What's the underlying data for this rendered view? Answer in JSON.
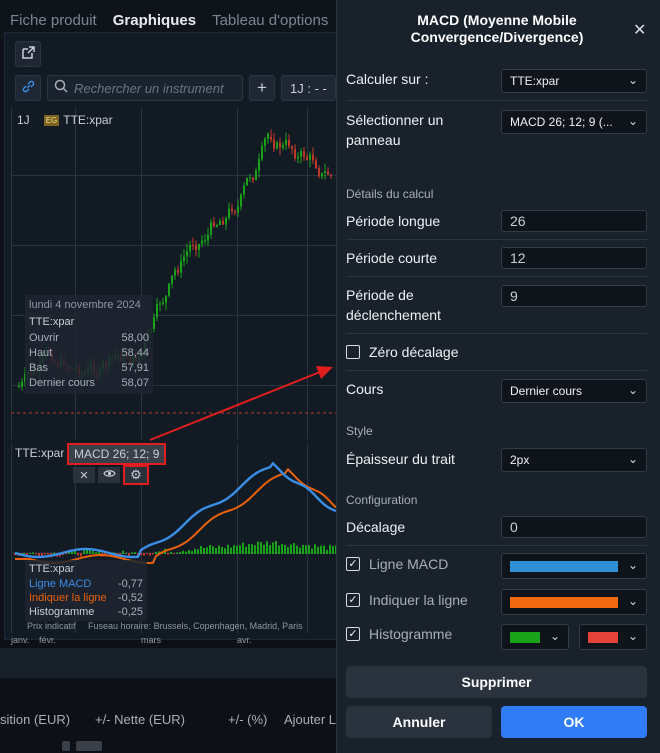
{
  "tabs": [
    "Fiche produit",
    "Graphiques",
    "Tableau d'options"
  ],
  "chart": {
    "search_placeholder": "Rechercher un instrument",
    "timeframe": "1J : - -",
    "period_label": "1J",
    "exchange_badge": "EG",
    "instrument": "TTE:xpar",
    "tooltip_main": {
      "date": "lundi 4 novembre 2024",
      "symbol": "TTE:xpar",
      "rows": [
        {
          "label": "Ouvrir",
          "value": "58,00"
        },
        {
          "label": "Haut",
          "value": "58,44"
        },
        {
          "label": "Bas",
          "value": "57,91"
        },
        {
          "label": "Dernier cours",
          "value": "58,07"
        }
      ]
    },
    "macd_label": "MACD 26; 12; 9",
    "sub_instrument": "TTE:xpar",
    "tooltip_sub": {
      "symbol": "TTE:xpar",
      "rows": [
        {
          "label": "Ligne MACD",
          "value": "-0,77",
          "color": "#3a8ee6"
        },
        {
          "label": "Indiquer la ligne",
          "value": "-0,52",
          "color": "#e8620c"
        },
        {
          "label": "Histogramme",
          "value": "-0,25",
          "color": "#c8cfd9"
        }
      ]
    },
    "axis_note": "Prix indicatif",
    "timezone": "Fuseau horaire: Brussels, Copenhagen, Madrid, Paris",
    "months": [
      "janv.",
      "févr.",
      "mars",
      "avr."
    ]
  },
  "bottom_headers": {
    "position": "sition (EUR)",
    "net": "+/- Nette (EUR)",
    "pct": "+/- (%)",
    "add": "Ajouter L"
  },
  "dialog": {
    "title": "MACD (Moyenne Mobile Convergence/Divergence)",
    "calc_on_label": "Calculer sur :",
    "calc_on_value": "TTE:xpar",
    "panel_label": "Sélectionner un panneau",
    "panel_value": "MACD 26; 12; 9 (...",
    "details_section": "Détails du calcul",
    "long_period_label": "Période longue",
    "long_period_value": "26",
    "short_period_label": "Période courte",
    "short_period_value": "12",
    "trigger_label": "Période de déclenchement",
    "trigger_value": "9",
    "zero_offset_label": "Zéro décalage",
    "price_label": "Cours",
    "price_value": "Dernier cours",
    "style_section": "Style",
    "thickness_label": "Épaisseur du trait",
    "thickness_value": "2px",
    "config_section": "Configuration",
    "offset_label": "Décalage",
    "offset_value": "0",
    "macd_line_label": "Ligne MACD",
    "signal_line_label": "Indiquer la ligne",
    "histogram_label": "Histogramme",
    "colors": {
      "macd": "#2f8fd8",
      "signal": "#f0680f",
      "hist_up": "#1aa31a",
      "hist_down": "#e5423a"
    },
    "delete_label": "Supprimer",
    "cancel_label": "Annuler",
    "ok_label": "OK"
  }
}
